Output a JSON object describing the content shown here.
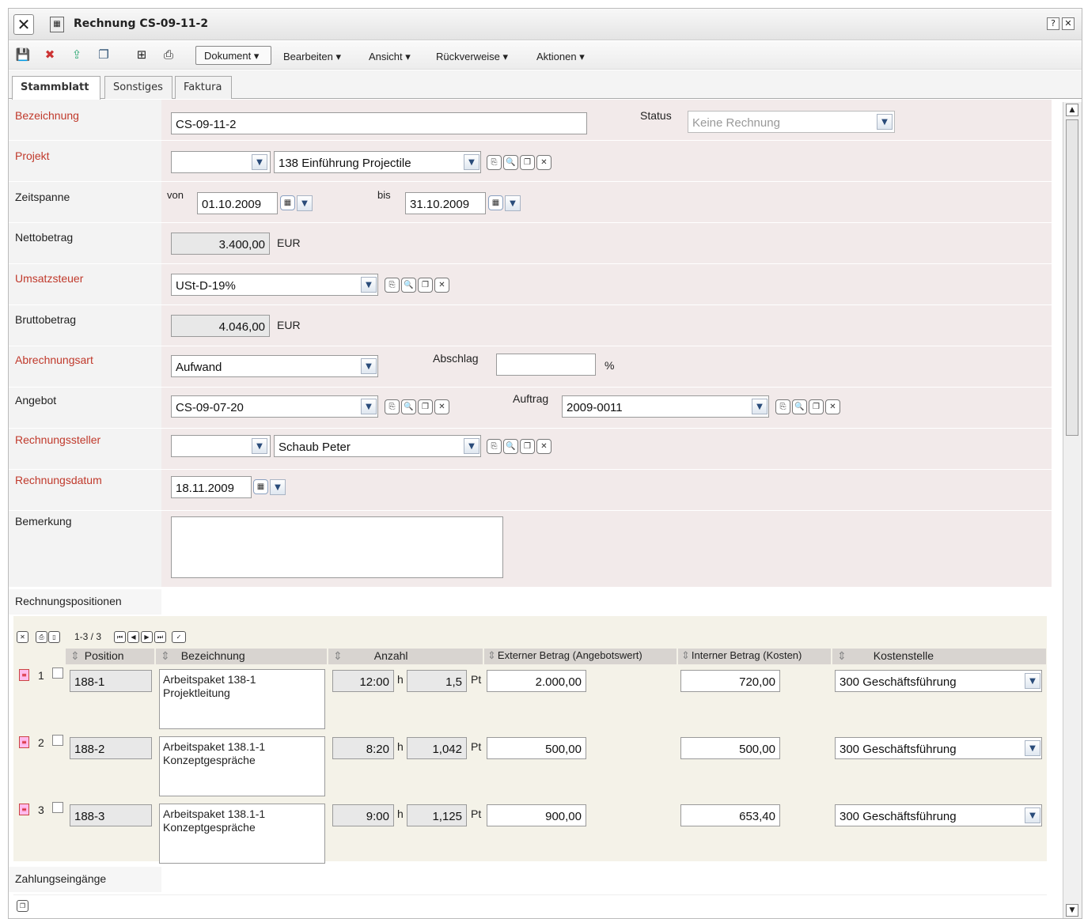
{
  "window": {
    "title": "Rechnung CS-09-11-2"
  },
  "toolbar": {
    "menus": [
      "Dokument",
      "Bearbeiten",
      "Ansicht",
      "Rückverweise",
      "Aktionen"
    ]
  },
  "tabs": [
    "Stammblatt",
    "Sonstiges",
    "Faktura"
  ],
  "form": {
    "bezeichnung": {
      "label": "Bezeichnung",
      "value": "CS-09-11-2"
    },
    "status": {
      "label": "Status",
      "value": "Keine Rechnung"
    },
    "projekt": {
      "label": "Projekt",
      "value": "138 Einführung Projectile"
    },
    "zeitspanne": {
      "label": "Zeitspanne",
      "von_label": "von",
      "von": "01.10.2009",
      "bis_label": "bis",
      "bis": "31.10.2009"
    },
    "netto": {
      "label": "Nettobetrag",
      "value": "3.400,00",
      "currency": "EUR"
    },
    "ust": {
      "label": "Umsatzsteuer",
      "value": "USt-D-19%"
    },
    "brutto": {
      "label": "Bruttobetrag",
      "value": "4.046,00",
      "currency": "EUR"
    },
    "abrechnungsart": {
      "label": "Abrechnungsart",
      "value": "Aufwand",
      "abschlag_label": "Abschlag",
      "abschlag": "",
      "percent": "%"
    },
    "angebot": {
      "label": "Angebot",
      "value": "CS-09-07-20",
      "auftrag_label": "Auftrag",
      "auftrag": "2009-0011"
    },
    "rechnungssteller": {
      "label": "Rechnungssteller",
      "value": "Schaub Peter"
    },
    "rechnungsdatum": {
      "label": "Rechnungsdatum",
      "value": "18.11.2009"
    },
    "bemerkung": {
      "label": "Bemerkung",
      "value": ""
    }
  },
  "positionen": {
    "title": "Rechnungspositionen",
    "paging": "1-3 / 3",
    "headers": [
      "Position",
      "Bezeichnung",
      "Anzahl",
      "Externer Betrag (Angebotswert)",
      "Interner Betrag (Kosten)",
      "Kostenstelle"
    ],
    "unit_h": "h",
    "unit_pt": "Pt",
    "rows": [
      {
        "nr": "1",
        "position": "188-1",
        "bez1": "Arbeitspaket 138-1",
        "bez2": "Projektleitung",
        "zeit": "12:00",
        "pt": "1,5",
        "extern": "2.000,00",
        "intern": "720,00",
        "kst": "300 Geschäftsführung"
      },
      {
        "nr": "2",
        "position": "188-2",
        "bez1": "Arbeitspaket 138.1-1",
        "bez2": "Konzeptgespräche",
        "zeit": "8:20",
        "pt": "1,042",
        "extern": "500,00",
        "intern": "500,00",
        "kst": "300 Geschäftsführung"
      },
      {
        "nr": "3",
        "position": "188-3",
        "bez1": "Arbeitspaket 138.1-1",
        "bez2": "Konzeptgespräche",
        "zeit": "9:00",
        "pt": "1,125",
        "extern": "900,00",
        "intern": "653,40",
        "kst": "300 Geschäftsführung"
      }
    ]
  },
  "zahlungen": {
    "title": "Zahlungseingänge"
  }
}
